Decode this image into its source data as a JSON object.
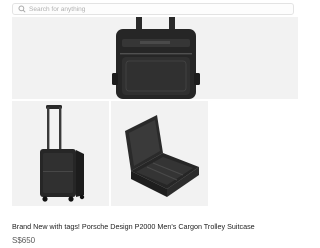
{
  "search": {
    "placeholder": "Search for anything",
    "icon": "search-icon"
  },
  "listing": {
    "title": "Brand New with tags! Porsche Design P2000 Men's Cargon Trolley Suitcase",
    "price": "S$650"
  },
  "gallery": [
    {
      "view": "front-close-up"
    },
    {
      "view": "full-upright-with-handle"
    },
    {
      "view": "open-interior"
    }
  ]
}
